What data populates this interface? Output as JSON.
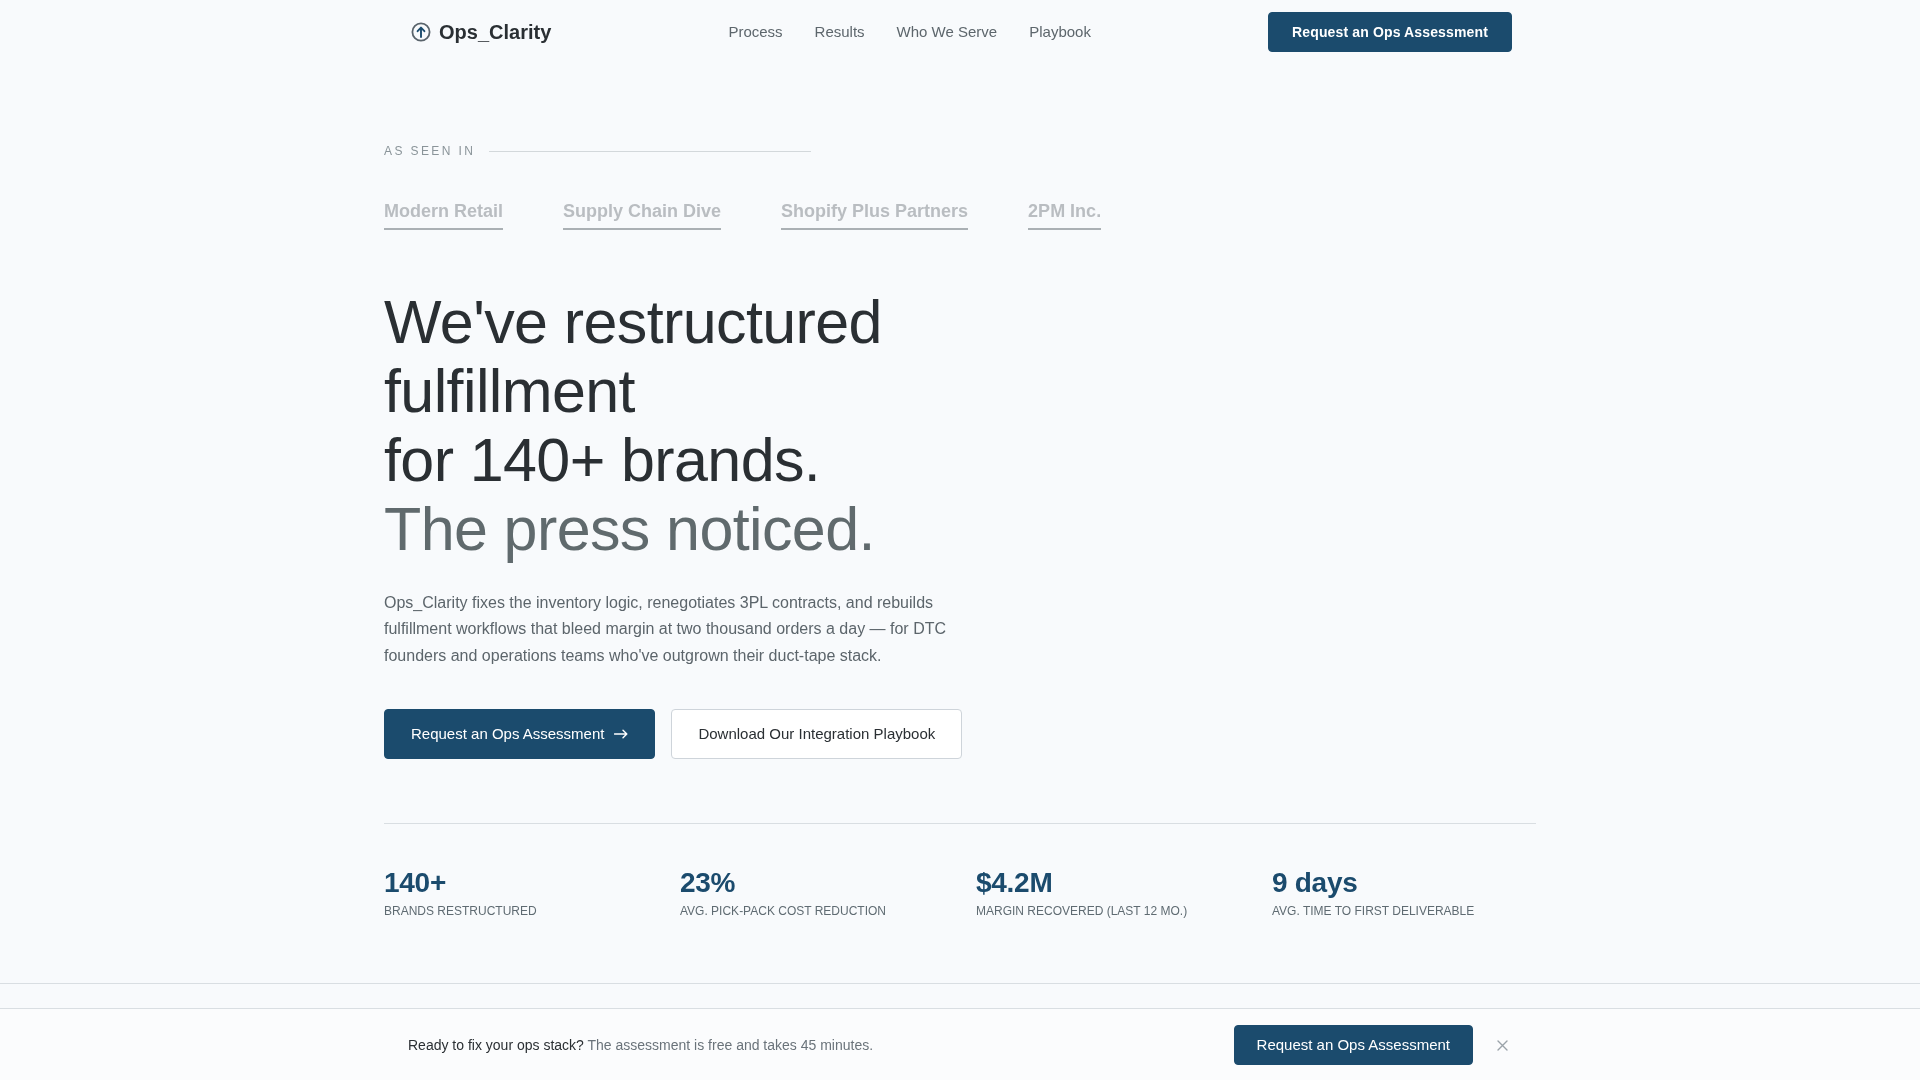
{
  "nav": {
    "brand": "Ops_Clarity",
    "links": [
      {
        "label": "Process"
      },
      {
        "label": "Results"
      },
      {
        "label": "Who We Serve"
      },
      {
        "label": "Playbook"
      }
    ],
    "cta": "Request an Ops Assessment"
  },
  "press": {
    "label": "AS SEEN IN",
    "outlets": [
      "Modern Retail",
      "Supply Chain Dive",
      "Shopify Plus Partners",
      "2PM Inc."
    ]
  },
  "hero": {
    "headline": [
      "We've restructured fulfillment",
      "for 140+ brands."
    ],
    "headline_muted": "The press noticed.",
    "lede": "Ops_Clarity fixes the inventory logic, renegotiates 3PL contracts, and rebuilds fulfillment workflows that bleed margin at two thousand orders a day — for DTC founders and operations teams who've outgrown their duct-tape stack.",
    "primary_button": "Request an Ops Assessment",
    "secondary_button": "Download Our Integration Playbook"
  },
  "stats": [
    {
      "value": "140+",
      "label": "BRANDS RESTRUCTURED"
    },
    {
      "value": "23%",
      "label": "AVG. PICK-PACK COST REDUCTION"
    },
    {
      "value": "$4.2M",
      "label": "MARGIN RECOVERED (LAST 12 MO.)"
    },
    {
      "value": "9 days",
      "label": "AVG. TIME TO FIRST DELIVERABLE"
    }
  ],
  "sticky_bar": {
    "lead": "Ready to fix your ops stack?",
    "text": "The assessment is free and takes 45 minutes.",
    "button": "Request an Ops Assessment"
  }
}
